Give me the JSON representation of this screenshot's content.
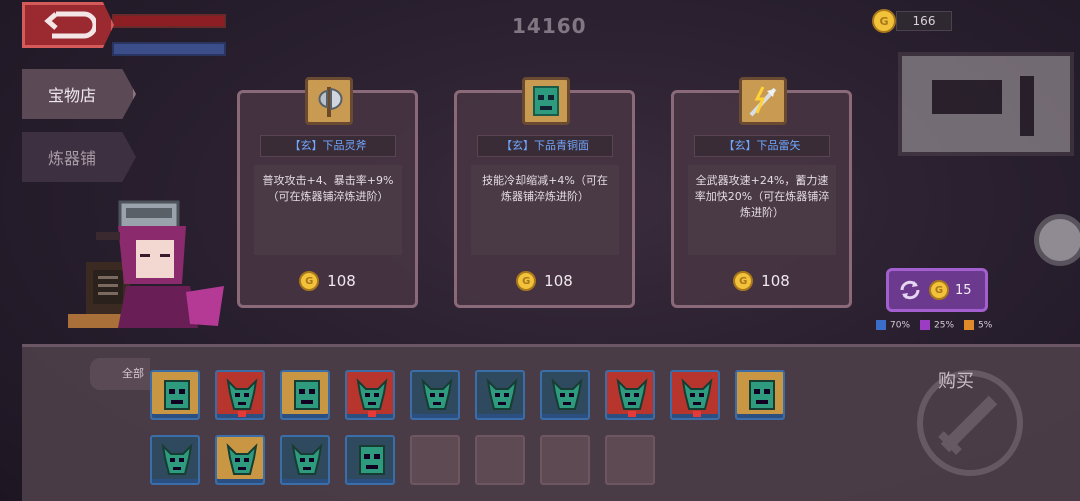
{
  "hud": {
    "score": "14160",
    "gold": "166"
  },
  "tabs": {
    "shop": "宝物店",
    "forge": "炼器铺"
  },
  "cards": [
    {
      "name": "【玄】下品灵斧",
      "desc": "普攻攻击+4、暴击率+9%（可在炼器铺淬炼进阶）",
      "price": "108",
      "icon": "axe-icon"
    },
    {
      "name": "【玄】下品青铜面",
      "desc": "技能冷却缩减+4%（可在炼器铺淬炼进阶）",
      "price": "108",
      "icon": "bronze-mask-icon"
    },
    {
      "name": "【玄】下品雷矢",
      "desc": "全武器攻速+24%，蓄力速率加快20%（可在炼器铺淬炼进阶）",
      "price": "108",
      "icon": "thunder-arrow-icon"
    }
  ],
  "refresh": {
    "cost": "15",
    "odds": [
      {
        "label": "70%",
        "color": "#3b6ec8"
      },
      {
        "label": "25%",
        "color": "#9a3cc4"
      },
      {
        "label": "5%",
        "color": "#e08a2a"
      }
    ]
  },
  "inventory": {
    "filter_label": "全部",
    "buy_label": "购买",
    "slots": [
      {
        "type": "gold",
        "icon": "green-mask-icon"
      },
      {
        "type": "red",
        "icon": "horned-mask-icon",
        "tag": true
      },
      {
        "type": "gold",
        "icon": "green-mask-icon"
      },
      {
        "type": "red",
        "icon": "horned-mask-icon",
        "tag": true
      },
      {
        "type": "teal",
        "icon": "horned-mask-icon"
      },
      {
        "type": "teal",
        "icon": "horned-mask-icon"
      },
      {
        "type": "teal",
        "icon": "horned-mask-icon"
      },
      {
        "type": "red",
        "icon": "horned-mask-icon",
        "tag": true
      },
      {
        "type": "red",
        "icon": "horned-mask-icon",
        "tag": true
      },
      {
        "type": "gold",
        "icon": "green-mask-icon"
      },
      {
        "type": "teal",
        "icon": "horned-mask-icon"
      },
      {
        "type": "gold",
        "icon": "horned-mask-icon"
      },
      {
        "type": "teal",
        "icon": "horned-mask-icon"
      },
      {
        "type": "teal",
        "icon": "green-mask-icon"
      },
      {
        "type": "empty"
      },
      {
        "type": "empty"
      },
      {
        "type": "empty"
      },
      {
        "type": "empty"
      }
    ]
  },
  "colors": {
    "rarity_name": "#6fa6ff",
    "coin": "#f2c23a",
    "back_button": "#9a2a30",
    "refresh_button": "#6b3a8e"
  }
}
